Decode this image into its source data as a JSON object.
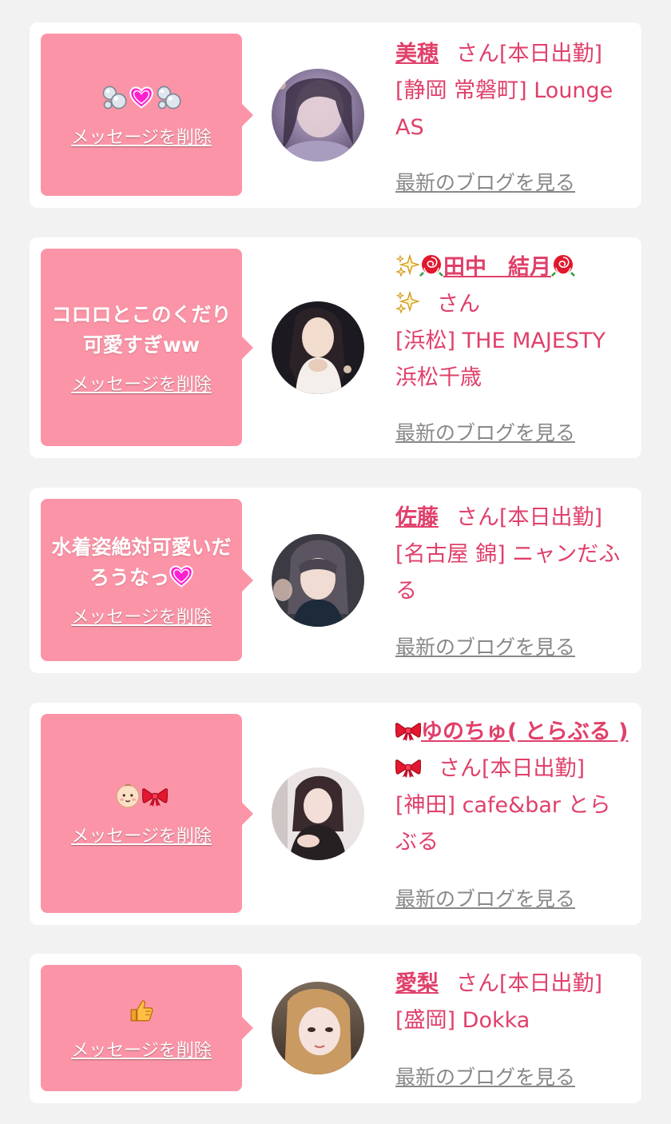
{
  "common": {
    "delete_label": "メッセージを削除",
    "blog_label": "最新のブログを見る",
    "san": "さん"
  },
  "colors": {
    "page_bg": "#f2f2f2",
    "bubble": "#fc94a7",
    "accent_text": "#e0406a",
    "blog_link": "#888888"
  },
  "cards": [
    {
      "message_icons": [
        "bubbles-icon",
        "heart-icon",
        "bubbles-icon"
      ],
      "name": "美穂",
      "suffix": "さん[本日出勤]",
      "area_shop": "[静岡 常磐町] Lounge AS"
    },
    {
      "message": "コロロとこのくだり可愛すぎww",
      "name_prefix_icons": [
        "sparkles-icon",
        "rose-icon"
      ],
      "name": "田中　結月",
      "name_suffix_icons": [
        "rose-icon",
        "sparkles-icon"
      ],
      "suffix": "さん",
      "area_shop": "[浜松] THE MAJESTY 浜松千歳"
    },
    {
      "message": "水着姿絶対可愛いだろうなっ",
      "message_icon": "heart-icon",
      "name": "佐藤",
      "suffix": "さん[本日出勤]",
      "area_shop": "[名古屋 錦] ニャンだふる"
    },
    {
      "message_icons": [
        "baby-face-icon",
        "ribbon-icon"
      ],
      "name_prefix_icon": "ribbon-icon",
      "name": "ゆのちゅ( とらぶる )",
      "name_suffix_icon": "ribbon-icon",
      "suffix": "さん[本日出勤]",
      "area_shop": "[神田] cafe&bar とらぶる"
    },
    {
      "message_icons": [
        "thumbs-up-icon"
      ],
      "name": "愛梨",
      "suffix": "さん[本日出勤]",
      "area_shop": "[盛岡] Dokka"
    }
  ]
}
